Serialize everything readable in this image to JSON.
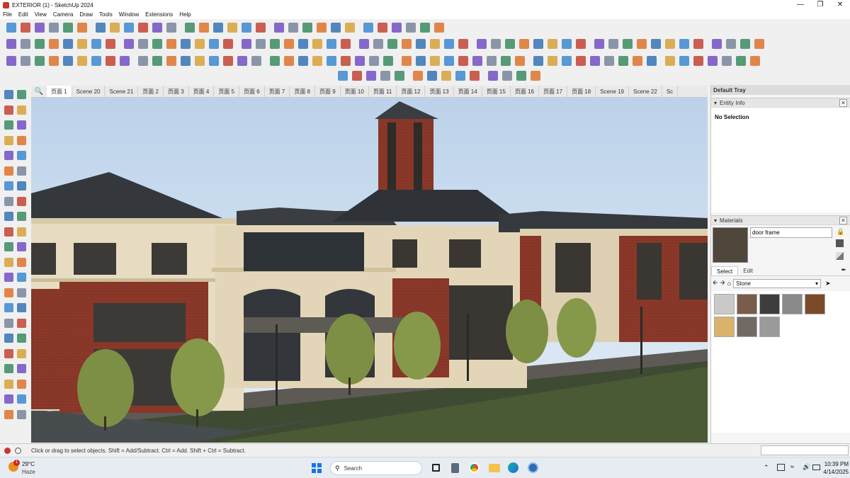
{
  "window": {
    "title": "EXTERIOR (1) - SketchUp 2024"
  },
  "menu": [
    "File",
    "Edit",
    "View",
    "Camera",
    "Draw",
    "Tools",
    "Window",
    "Extensions",
    "Help"
  ],
  "scene_tabs": [
    "页面 1",
    "Scene 20",
    "Scene 21",
    "页面 2",
    "页面 3",
    "页面 4",
    "页面 5",
    "页面 6",
    "页面 7",
    "页面 8",
    "页面 9",
    "页面 10",
    "页面 11",
    "页面 12",
    "页面 13",
    "页面 14",
    "页面 15",
    "页面 16",
    "页面 17",
    "页面 18",
    "Scene 19",
    "Scene 22",
    "Sc"
  ],
  "active_tab_index": 0,
  "tray": {
    "title": "Default Tray",
    "entity_info": {
      "title": "Entity Info",
      "selection": "No Selection"
    },
    "materials": {
      "title": "Materials",
      "name_value": "door frame",
      "current_color": "#4f463c",
      "tabs": [
        "Select",
        "Edit"
      ],
      "active_tab": "Select",
      "library": "Stone",
      "swatches": [
        "#c9c9c7",
        "#7a5c4a",
        "#3d3d3d",
        "#8a8a88",
        "#7b4a2a",
        "#d9b36a",
        "#706a63",
        "#9a9a98"
      ]
    }
  },
  "status": {
    "hint": "Click or drag to select objects. Shift = Add/Subtract. Ctrl = Add. Shift + Ctrl = Subtract."
  },
  "taskbar": {
    "weather_temp": "29°C",
    "weather_desc": "Haze",
    "weather_badge": "1",
    "search_placeholder": "Search",
    "time": "10:39 PM",
    "date": "4/14/2025"
  }
}
